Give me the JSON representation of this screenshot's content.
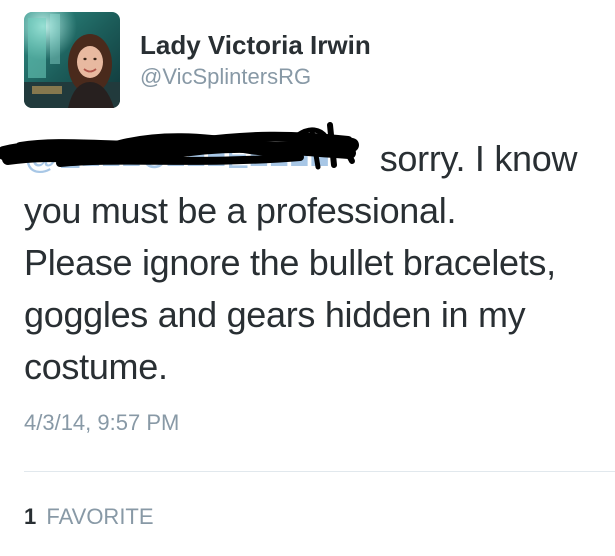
{
  "user": {
    "display_name": "Lady Victoria Irwin",
    "handle": "@VicSplintersRG"
  },
  "tweet": {
    "mention_redacted": "@E■■■C■■■E■■■■",
    "line1_rest": "sorry. I know",
    "line2": "you must be a professional.",
    "line3": "Please ignore the bullet bracelets,",
    "line4": "goggles and gears hidden in my",
    "line5": "costume.",
    "timestamp": "4/3/14, 9:57 PM"
  },
  "stats": {
    "favorite_count": "1",
    "favorite_label": "FAVORITE"
  },
  "colors": {
    "text": "#292f33",
    "secondary": "#8899a6",
    "mention": "#a8c7e6",
    "divider": "#e1e8ed"
  }
}
